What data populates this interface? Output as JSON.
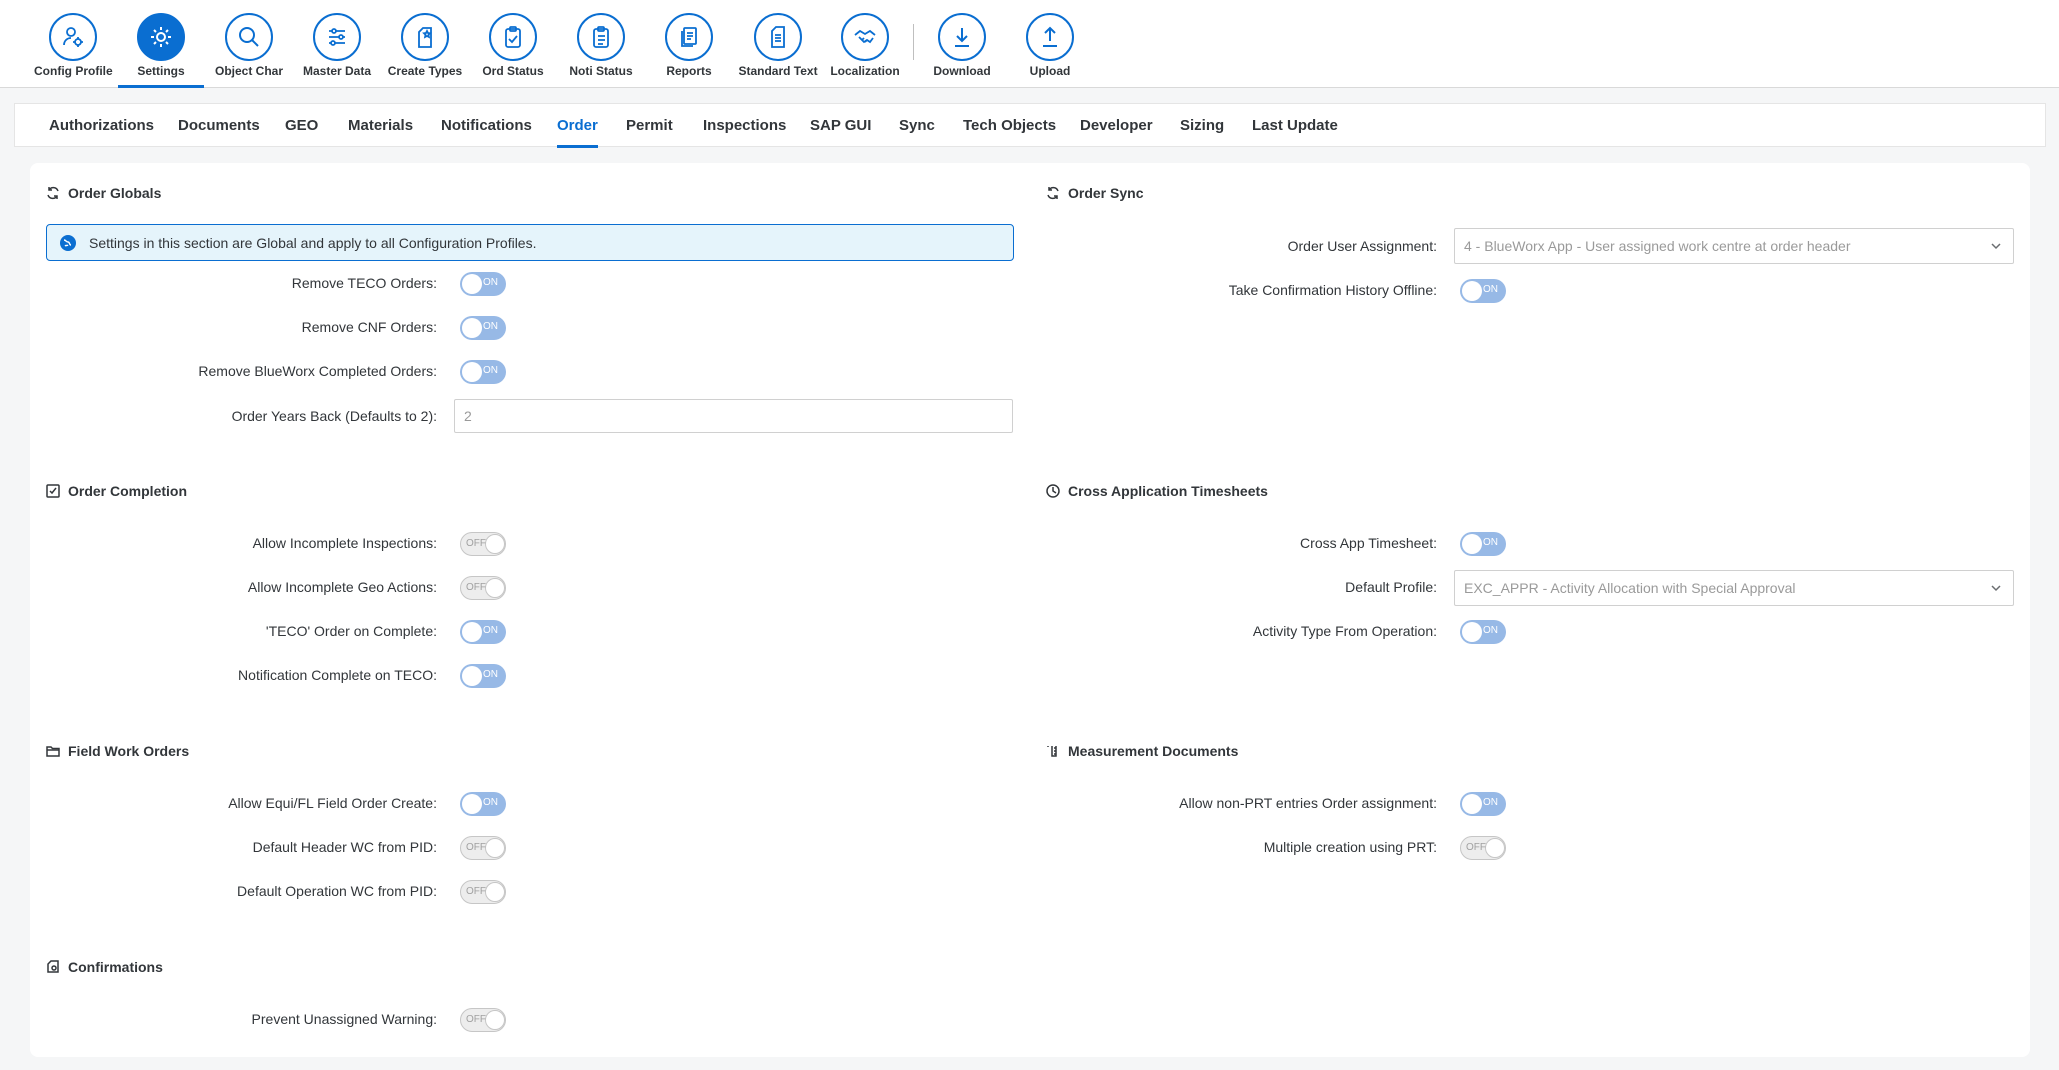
{
  "toolbar": {
    "items": [
      {
        "label": "Config Profile",
        "icon": "config-profile-icon"
      },
      {
        "label": "Settings",
        "icon": "gear-icon"
      },
      {
        "label": "Object Char",
        "icon": "search-icon"
      },
      {
        "label": "Master Data",
        "icon": "sliders-icon"
      },
      {
        "label": "Create Types",
        "icon": "create-types-icon"
      },
      {
        "label": "Ord Status",
        "icon": "clipboard-check-icon"
      },
      {
        "label": "Noti Status",
        "icon": "clipboard-list-icon"
      },
      {
        "label": "Reports",
        "icon": "reports-icon"
      },
      {
        "label": "Standard Text",
        "icon": "document-icon"
      },
      {
        "label": "Localization",
        "icon": "handshake-icon"
      },
      {
        "label": "Download",
        "icon": "download-icon"
      },
      {
        "label": "Upload",
        "icon": "upload-icon"
      }
    ],
    "active": "Settings"
  },
  "tabs": {
    "items": [
      "Authorizations",
      "Documents",
      "GEO",
      "Materials",
      "Notifications",
      "Order",
      "Permit",
      "Inspections",
      "SAP GUI",
      "Sync",
      "Tech Objects",
      "Developer",
      "Sizing",
      "Last Update"
    ],
    "active": "Order"
  },
  "order_globals": {
    "title": "Order Globals",
    "info": "Settings in this section are Global and apply to all Configuration Profiles.",
    "fields": [
      {
        "label": "Remove TECO Orders:",
        "state": "ON"
      },
      {
        "label": "Remove CNF Orders:",
        "state": "ON"
      },
      {
        "label": "Remove BlueWorx Completed Orders:",
        "state": "ON"
      }
    ],
    "years_back": {
      "label": "Order Years Back (Defaults to 2):",
      "value": "2"
    }
  },
  "order_sync": {
    "title": "Order Sync",
    "user_assignment": {
      "label": "Order User Assignment:",
      "value": "4 - BlueWorx App - User assigned work centre at order header"
    },
    "fields": [
      {
        "label": "Take Confirmation History Offline:",
        "state": "ON"
      }
    ]
  },
  "order_completion": {
    "title": "Order Completion",
    "fields": [
      {
        "label": "Allow Incomplete Inspections:",
        "state": "OFF"
      },
      {
        "label": "Allow Incomplete Geo Actions:",
        "state": "OFF"
      },
      {
        "label": "'TECO' Order on Complete:",
        "state": "ON"
      },
      {
        "label": "Notification Complete on TECO:",
        "state": "ON"
      }
    ]
  },
  "cross_app": {
    "title": "Cross Application Timesheets",
    "timesheet": {
      "label": "Cross App Timesheet:",
      "state": "ON"
    },
    "default_profile": {
      "label": "Default Profile:",
      "value": "EXC_APPR - Activity Allocation with Special Approval"
    },
    "activity_type": {
      "label": "Activity Type From Operation:",
      "state": "ON"
    }
  },
  "field_work_orders": {
    "title": "Field Work Orders",
    "fields": [
      {
        "label": "Allow Equi/FL Field Order Create:",
        "state": "ON"
      },
      {
        "label": "Default Header WC from PID:",
        "state": "OFF"
      },
      {
        "label": "Default Operation WC from PID:",
        "state": "OFF"
      }
    ]
  },
  "measurement_docs": {
    "title": "Measurement Documents",
    "fields": [
      {
        "label": "Allow non-PRT entries Order assignment:",
        "state": "ON"
      },
      {
        "label": "Multiple creation using PRT:",
        "state": "OFF"
      }
    ]
  },
  "confirmations": {
    "title": "Confirmations",
    "fields": [
      {
        "label": "Prevent Unassigned Warning:",
        "state": "OFF"
      }
    ]
  },
  "colors": {
    "accent": "#0a6ed1",
    "switch_on": "#97b9e6",
    "info_bg": "#e5f4fb"
  }
}
